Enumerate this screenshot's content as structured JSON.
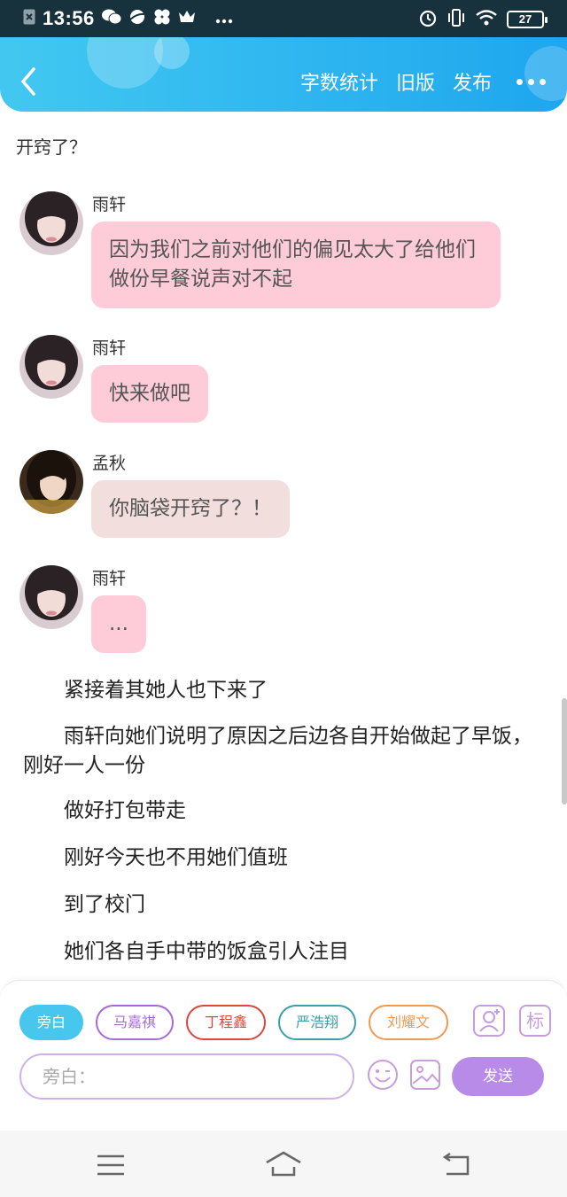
{
  "status_bar": {
    "time": "13:56",
    "battery": "27"
  },
  "header": {
    "actions": [
      "字数统计",
      "旧版",
      "发布"
    ]
  },
  "intro_text": "开窍了？",
  "messages": [
    {
      "sender": "雨轩",
      "text": "因为我们之前对他们的偏见太大了给他们做份早餐说声对不起",
      "avatar": "avatar-yuxuan"
    },
    {
      "sender": "雨轩",
      "text": "快来做吧",
      "avatar": "avatar-yuxuan"
    },
    {
      "sender": "孟秋",
      "text": "你脑袋开窍了？！",
      "avatar": "avatar-mengqiu"
    },
    {
      "sender": "雨轩",
      "text": "...",
      "avatar": "avatar-yuxuan"
    }
  ],
  "narration": [
    "紧接着其她人也下来了",
    "雨轩向她们说明了原因之后边各自开始做起了早饭，刚好一人一份",
    "做好打包带走",
    "刚好今天也不用她们值班",
    "到了校门",
    "她们各自手中带的饭盒引人注目"
  ],
  "role_chips": [
    {
      "label": "旁白",
      "color": "#47c6ee",
      "active": true
    },
    {
      "label": "马嘉祺",
      "color": "#a86ad6",
      "active": false
    },
    {
      "label": "丁程鑫",
      "color": "#d9473d",
      "active": false
    },
    {
      "label": "严浩翔",
      "color": "#3aa0a6",
      "active": false
    },
    {
      "label": "刘耀文",
      "color": "#ee9a56",
      "active": false
    }
  ],
  "input": {
    "placeholder": "旁白："
  },
  "send_label": "发送",
  "tool_icons": [
    "person-add-icon",
    "tag-icon",
    "emoji-icon",
    "image-icon"
  ],
  "tag_label": "标"
}
